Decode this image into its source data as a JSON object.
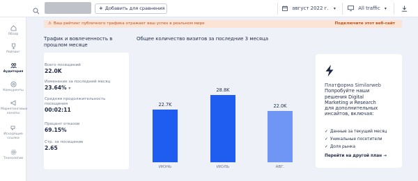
{
  "topbar": {
    "compare_label": "Добавить для сравнения",
    "date_label": "август 2022 г.",
    "traffic_label": "All traffic"
  },
  "sidebar": {
    "items": [
      {
        "label": "Обзор",
        "icon": "home-icon"
      },
      {
        "label": "Рейтинг",
        "icon": "trophy-icon"
      },
      {
        "label": "Аудитория",
        "icon": "users-icon",
        "active": true
      },
      {
        "label": "Конкуренты",
        "icon": "target-icon"
      },
      {
        "label": "Маркетинговые каналы",
        "icon": "megaphone-icon"
      },
      {
        "label": "Исходящие ссылки",
        "icon": "link-icon"
      },
      {
        "label": "Технологии",
        "icon": "gear-icon"
      }
    ]
  },
  "banner": {
    "text": "Ваш рейтинг публичного трафика отражает ваш успех в реальном мире",
    "link": "Подключите этот веб-сайт"
  },
  "engagement": {
    "title_line1": "Трафик и вовлеченность в",
    "title_line2": "прошлом месяце",
    "stats": [
      {
        "label": "Всего посещений",
        "value": "22.0K"
      },
      {
        "label": "Изменение за последний месяц",
        "value": "23.64%",
        "trend": "down"
      },
      {
        "label": "Средняя продолжительность посещения",
        "label_line1": "Средняя продолжительность",
        "label_line2": "посещения",
        "value": "00:02:11"
      },
      {
        "label": "Процент отказов",
        "value": "69.15%"
      },
      {
        "label": "Стр. за посещение",
        "value": "2.65"
      }
    ]
  },
  "chart_title": "Общее количество визитов за последние 3 месяца",
  "chart_data": {
    "type": "bar",
    "categories": [
      "ИЮНЬ",
      "ИЮЛЬ",
      "АВГ."
    ],
    "values": [
      22700,
      28800,
      22000
    ],
    "value_labels": [
      "22.7K",
      "28.8K",
      "22.0K"
    ],
    "colors": [
      "#1f5cf0",
      "#1f5cf0",
      "#6f95f5"
    ],
    "ylim": [
      0,
      30000
    ]
  },
  "promo": {
    "line1": "Платформа Similarweb",
    "line2": "Попробуйте наши",
    "line3": "решения Digital",
    "line4": "Marketing и Research",
    "line5": "для дополнительных",
    "line6": "инсайтов, включая:",
    "bullets": [
      "Данные за текущий месяц",
      "Уникальные посетители",
      "Доля рынка"
    ],
    "link": "Перейти на другой план"
  },
  "colors": {
    "accent": "#1f5cf0",
    "accent_light": "#6f95f5",
    "banner_bg": "#fbe3d6",
    "banner_text": "#c0531c"
  }
}
